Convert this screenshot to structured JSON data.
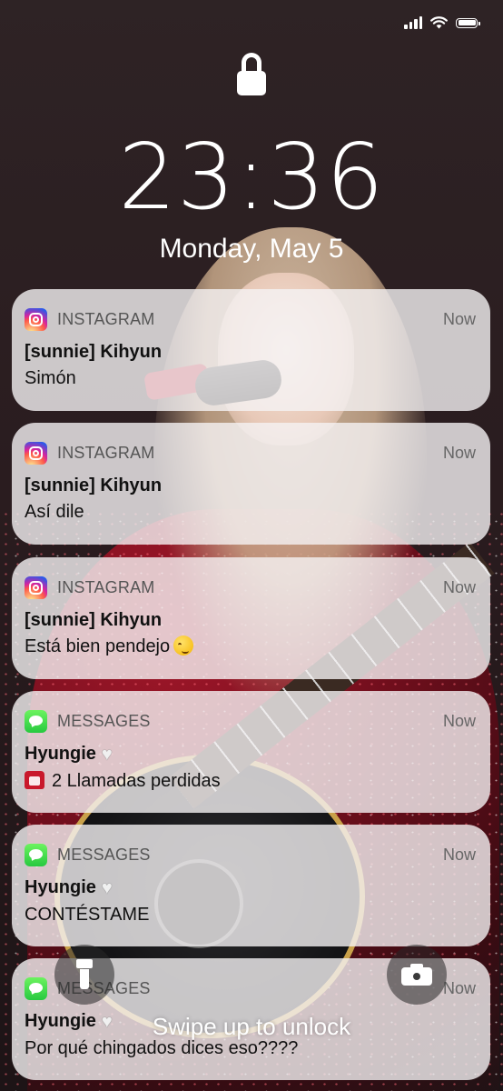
{
  "status_bar": {
    "icons": [
      "cellular-signal-icon",
      "wifi-icon",
      "battery-icon"
    ],
    "battery_level": 1.0
  },
  "lock_screen": {
    "time": "23:36",
    "date": "Monday, May 5",
    "swipe_hint": "Swipe up to unlock"
  },
  "notifications": [
    {
      "app": "INSTAGRAM",
      "icon": "instagram-icon",
      "time": "Now",
      "title": "[sunnie] Kihyun",
      "body": "Simón"
    },
    {
      "app": "INSTAGRAM",
      "icon": "instagram-icon",
      "time": "Now",
      "title": "[sunnie] Kihyun",
      "body": "Así dile"
    },
    {
      "app": "INSTAGRAM",
      "icon": "instagram-icon",
      "time": "Now",
      "title": "[sunnie] Kihyun",
      "body": "Está bien pendejo",
      "body_emoji": "woozy-face-icon"
    },
    {
      "app": "MESSAGES",
      "icon": "messages-icon",
      "time": "Now",
      "title": "Hyungie",
      "title_emoji": "white-heart-icon",
      "body_prefix_emoji": "telephone-icon",
      "body": "2 Llamadas perdidas"
    },
    {
      "app": "MESSAGES",
      "icon": "messages-icon",
      "time": "Now",
      "title": "Hyungie",
      "title_emoji": "white-heart-icon",
      "body": "CONTÉSTAME"
    },
    {
      "app": "MESSAGES",
      "icon": "messages-icon",
      "time": "Now",
      "title": "Hyungie",
      "title_emoji": "white-heart-icon",
      "body": "Por qué chingados dices eso????"
    }
  ],
  "quick_actions": {
    "left": "flashlight-icon",
    "right": "camera-icon"
  }
}
